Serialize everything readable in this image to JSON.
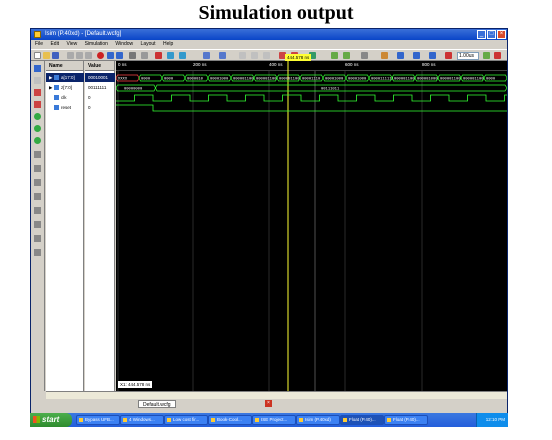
{
  "caption": "Simulation output",
  "window": {
    "title": "Isim (P.40xd) - [Default.wcfg]",
    "buttons": [
      "_",
      "□",
      "×"
    ]
  },
  "menu": [
    "File",
    "Edit",
    "View",
    "Simulation",
    "Window",
    "Layout",
    "Help"
  ],
  "toolbar": {
    "zoom_value": "1.00us"
  },
  "columns": {
    "name": "Name",
    "value": "Value"
  },
  "signals": [
    {
      "name": "a[17:0]",
      "value": "00010001",
      "kind": "bus",
      "selected": true
    },
    {
      "name": "z[7:0]",
      "value": "00111111",
      "kind": "bus",
      "selected": false
    },
    {
      "name": "clk",
      "value": "0",
      "kind": "bit",
      "selected": false
    },
    {
      "name": "reset",
      "value": "0",
      "kind": "bit",
      "selected": false
    }
  ],
  "ruler": {
    "labels": [
      "0 ns",
      "200 ns",
      "400 ns",
      "600 ns",
      "800 ns"
    ],
    "cursor_label": "444.578 ns"
  },
  "bus_a": [
    "XXXX",
    "0000",
    "0000",
    "0000010",
    "00001000",
    "000001100",
    "000001100",
    "000001100",
    "00001110",
    "00001000",
    "00001000",
    "0000111111",
    "000001100",
    "000001000",
    "000001100",
    "000001100",
    "0000"
  ],
  "bus_z": {
    "initial": "00000000",
    "later": "00111011"
  },
  "cursor_readout": "X1: 444.578 ns",
  "tabs": {
    "file_tab": "Default.wcfg",
    "close": "×"
  },
  "taskbar": {
    "start": "start",
    "items": [
      "Bypass UFB...",
      "4 Windows...",
      "Low cost fir...",
      "Book-Cool...",
      "ISE Project...",
      "Isim (P.40xd)",
      "Float (P.40)...",
      "Float (P.40)..."
    ],
    "clock": "12:10 PM"
  }
}
